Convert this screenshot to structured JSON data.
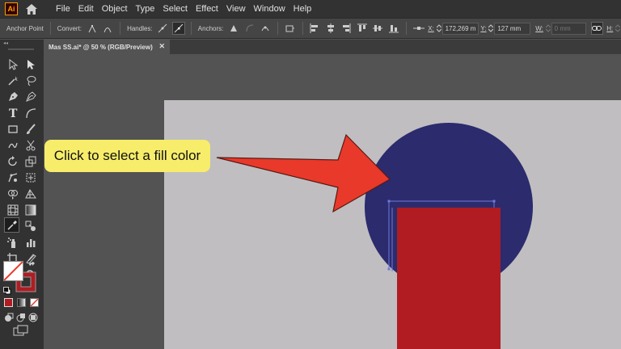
{
  "app": {
    "logo_text": "Ai"
  },
  "menu": [
    "File",
    "Edit",
    "Object",
    "Type",
    "Select",
    "Effect",
    "View",
    "Window",
    "Help"
  ],
  "control_bar": {
    "tool_name": "Anchor Point",
    "convert_label": "Convert:",
    "handles_label": "Handles:",
    "anchors_label": "Anchors:",
    "x_label": "X:",
    "x_value": "172,269 m",
    "y_label": "Y:",
    "y_value": "127 mm",
    "w_label": "W:",
    "w_value": "0 mm",
    "h_label": "H:"
  },
  "document_tab": {
    "title": "Mas SS.ai* @ 50 % (RGB/Preview)",
    "close_symbol": "✕"
  },
  "callout": {
    "text": "Click to select a fill color"
  },
  "colors": {
    "accent_red": "#e8392b",
    "circle_fill": "#2b2b6e",
    "rect_fill": "#b01c22",
    "callout_bg": "#f7ed6a",
    "artboard": "#c0bec0",
    "selection": "#6f78d9"
  },
  "tools": [
    "selection-tool-icon",
    "direct-selection-tool-icon",
    "magic-wand-tool-icon",
    "lasso-tool-icon",
    "pen-tool-icon",
    "curvature-tool-icon",
    "type-tool-icon",
    "arc-tool-icon",
    "rectangle-tool-icon",
    "paintbrush-tool-icon",
    "shaper-tool-icon",
    "scissors-tool-icon",
    "rotate-tool-icon",
    "scale-tool-icon",
    "puppet-warp-tool-icon",
    "free-transform-tool-icon",
    "shape-builder-tool-icon",
    "perspective-grid-tool-icon",
    "mesh-tool-icon",
    "gradient-tool-icon",
    "eyedropper-tool-icon",
    "blend-tool-icon",
    "symbol-sprayer-tool-icon",
    "column-graph-tool-icon",
    "artboard-tool-icon",
    "slice-tool-icon",
    "hand-tool-icon",
    "zoom-tool-icon"
  ]
}
